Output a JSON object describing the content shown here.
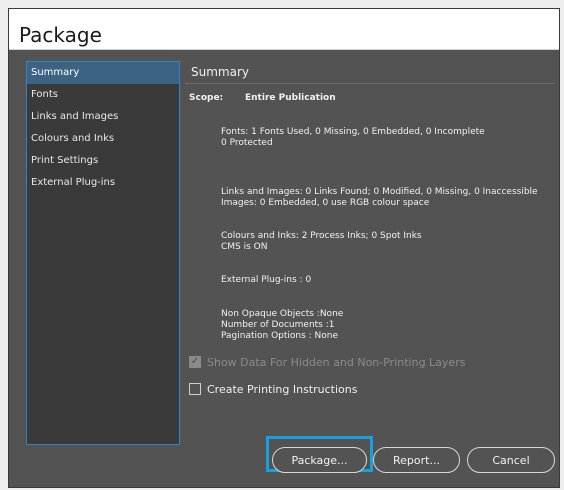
{
  "window": {
    "title": "Package"
  },
  "sidebar": {
    "items": [
      {
        "label": "Summary",
        "selected": true
      },
      {
        "label": "Fonts"
      },
      {
        "label": "Links and Images"
      },
      {
        "label": "Colours and Inks"
      },
      {
        "label": "Print Settings"
      },
      {
        "label": "External Plug-ins"
      }
    ]
  },
  "main": {
    "header": "Summary",
    "scope_label": "Scope:",
    "scope_value": "Entire Publication",
    "fonts": "Fonts: 1 Fonts Used, 0 Missing, 0 Embedded, 0 Incomplete\n0 Protected",
    "links": "Links and Images: 0 Links Found; 0 Modified, 0 Missing, 0 Inaccessible\nImages: 0 Embedded, 0 use RGB colour space",
    "colours": "Colours and Inks: 2 Process Inks; 0 Spot Inks\nCMS is ON",
    "plugins": "External Plug-ins : 0",
    "other": "Non Opaque Objects :None\nNumber of Documents :1\nPagination Options : None"
  },
  "options": {
    "show_hidden_label": "Show Data For Hidden and Non-Printing Layers",
    "show_hidden_checked": true,
    "show_hidden_disabled": true,
    "printing_instructions_label": "Create Printing Instructions",
    "printing_instructions_checked": false
  },
  "buttons": {
    "package": "Package...",
    "report": "Report...",
    "cancel": "Cancel"
  },
  "colors": {
    "dialog_bg": "#535353",
    "sidebar_bg": "#3a3a3a",
    "selection": "#3d6384",
    "focus_accent": "#1aa1dc"
  }
}
